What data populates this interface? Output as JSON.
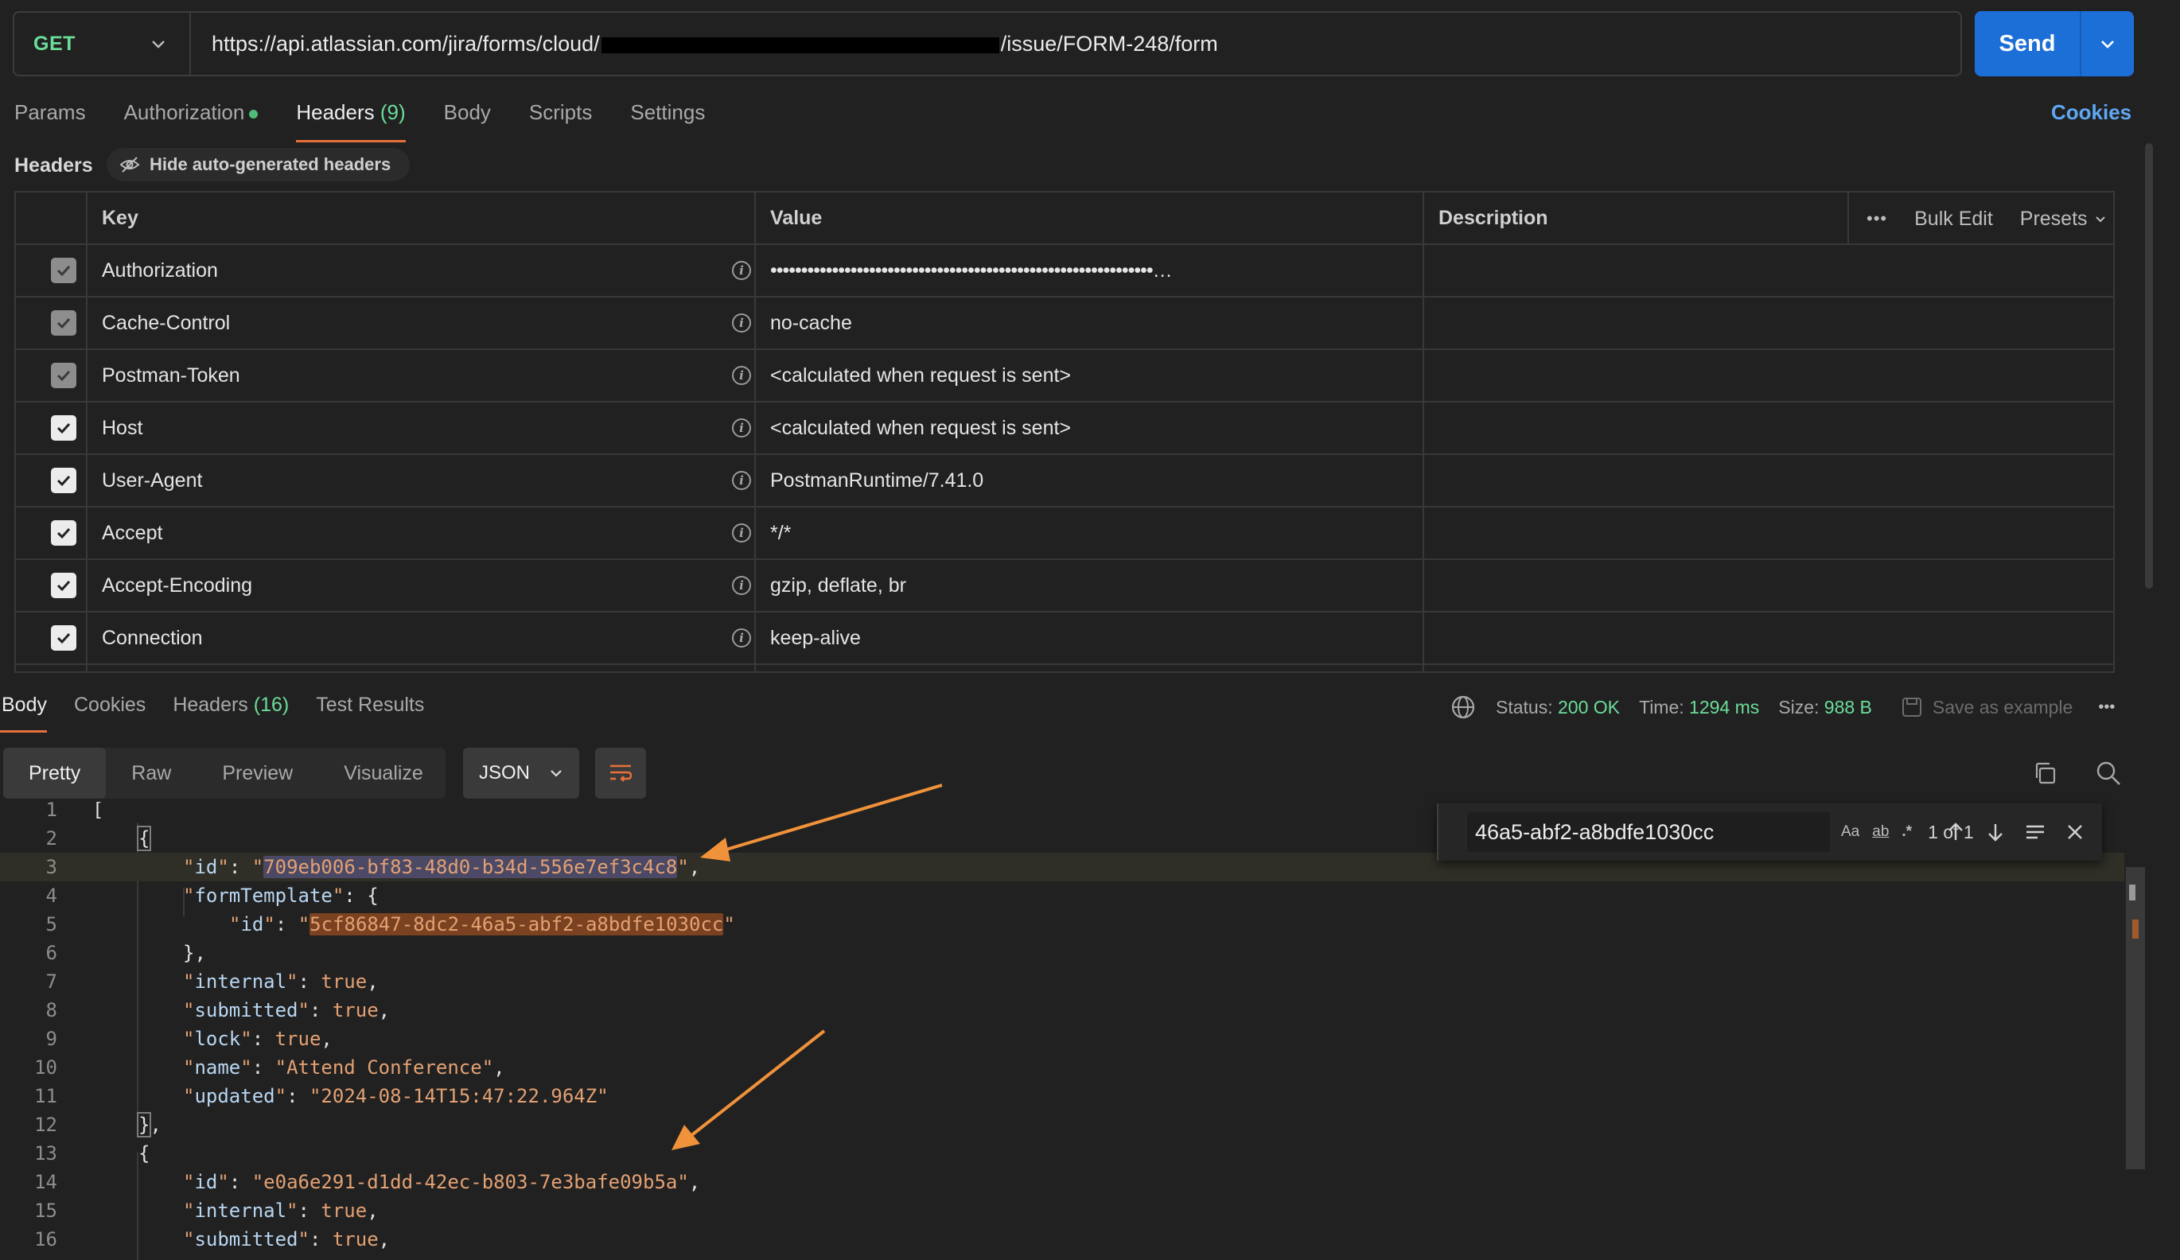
{
  "request": {
    "method": "GET",
    "url_prefix": "https://api.atlassian.com/jira/forms/cloud/",
    "url_suffix": "/issue/FORM-248/form",
    "send_label": "Send"
  },
  "request_tabs": [
    {
      "label": "Params",
      "count": ""
    },
    {
      "label": "Authorization",
      "count": ""
    },
    {
      "label": "Headers",
      "count": "(9)"
    },
    {
      "label": "Body",
      "count": ""
    },
    {
      "label": "Scripts",
      "count": ""
    },
    {
      "label": "Settings",
      "count": ""
    }
  ],
  "cookies_link": "Cookies",
  "headers_section": {
    "label": "Headers",
    "hide_auto": "Hide auto-generated headers",
    "columns": {
      "key": "Key",
      "value": "Value",
      "description": "Description"
    },
    "bulk_edit": "Bulk Edit",
    "presets": "Presets",
    "rows": [
      {
        "key": "Authorization",
        "value": "••••••••••••••••••••••••••••••••••••••••••••••••••••••••••••••…",
        "state": "dim"
      },
      {
        "key": "Cache-Control",
        "value": "no-cache",
        "state": "dim"
      },
      {
        "key": "Postman-Token",
        "value": "<calculated when request is sent>",
        "state": "dim"
      },
      {
        "key": "Host",
        "value": "<calculated when request is sent>",
        "state": "on"
      },
      {
        "key": "User-Agent",
        "value": "PostmanRuntime/7.41.0",
        "state": "on"
      },
      {
        "key": "Accept",
        "value": "*/*",
        "state": "on"
      },
      {
        "key": "Accept-Encoding",
        "value": "gzip, deflate, br",
        "state": "on"
      },
      {
        "key": "Connection",
        "value": "keep-alive",
        "state": "on"
      }
    ]
  },
  "response": {
    "tabs": [
      {
        "label": "Body",
        "count": ""
      },
      {
        "label": "Cookies",
        "count": ""
      },
      {
        "label": "Headers",
        "count": "(16)"
      },
      {
        "label": "Test Results",
        "count": ""
      }
    ],
    "status_label": "Status:",
    "status_value": "200 OK",
    "time_label": "Time:",
    "time_value": "1294 ms",
    "size_label": "Size:",
    "size_value": "988 B",
    "save_example": "Save as example",
    "format_tabs": [
      "Pretty",
      "Raw",
      "Preview",
      "Visualize"
    ],
    "format_selected": "JSON",
    "find": {
      "query": "46a5-abf2-a8bdfe1030cc",
      "count": "1 of 1",
      "opt_case": "Aa",
      "opt_word": "ab",
      "opt_regex": ".*"
    },
    "lines": [
      "1",
      "2",
      "3",
      "4",
      "5",
      "6",
      "7",
      "8",
      "9",
      "10",
      "11",
      "12",
      "13",
      "14",
      "15",
      "16"
    ],
    "code": {
      "l3_id": "709eb006-bf83-48d0-b34d-556e7ef3c4c8",
      "l5_id": "5cf86847-8dc2-46a5-abf2-a8bdfe1030cc",
      "l10_name": "Attend Conference",
      "l11_updated": "2024-08-14T15:47:22.964Z",
      "l14_id": "e0a6e291-d1dd-42ec-b803-7e3bafe09b5a"
    }
  },
  "colors": {
    "accent": "#e8703a",
    "send": "#1d6fd8",
    "ok": "#6bdd9a",
    "annotation_arrow": "#f0923a"
  }
}
